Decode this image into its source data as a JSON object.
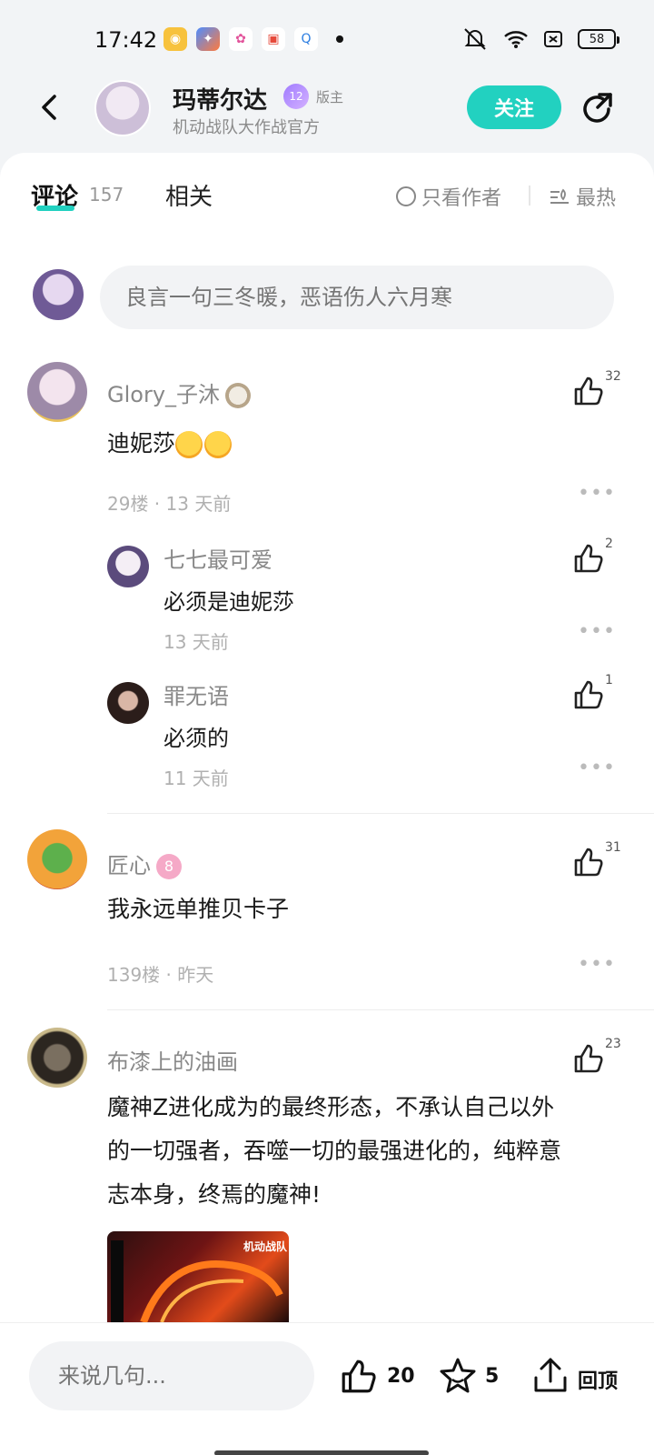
{
  "status_bar": {
    "time": "17:42",
    "battery": "58"
  },
  "header": {
    "name": "玛蒂尔达",
    "level": "12",
    "role": "版主",
    "subtitle": "机动战队大作战官方",
    "follow_label": "关注"
  },
  "tabs": {
    "comments_label": "评论",
    "comments_count": "157",
    "related_label": "相关",
    "author_only_label": "只看作者",
    "sort_label": "最热"
  },
  "composer": {
    "placeholder": "良言一句三冬暖，恶语伤人六月寒"
  },
  "comments": [
    {
      "name": "Glory_子沐",
      "text": "迪妮莎",
      "floor_time": "29楼 · 13 天前",
      "likes": "32",
      "replies": [
        {
          "name": "七七最可爱",
          "text": "必须是迪妮莎",
          "time": "13 天前",
          "likes": "2"
        },
        {
          "name": "罪无语",
          "text": "必须的",
          "time": "11 天前",
          "likes": "1"
        }
      ]
    },
    {
      "name": "匠心",
      "text": "我永远单推贝卡子",
      "floor_time": "139楼 · 昨天",
      "likes": "31"
    },
    {
      "name": "布漆上的油画",
      "text_lines": [
        "魔神Z进化成为的最终形态，不承认自己以外",
        "的一切强者，吞噬一切的最强进化的，纯粹意",
        "志本身，终焉的魔神!"
      ],
      "likes": "23",
      "image_caption": "机动战队"
    }
  ],
  "bottom_bar": {
    "input_placeholder": "来说几句...",
    "like_count": "20",
    "favorite_count": "5",
    "back_to_top_label": "回顶"
  },
  "colors": {
    "accent": "#22d1c0"
  }
}
